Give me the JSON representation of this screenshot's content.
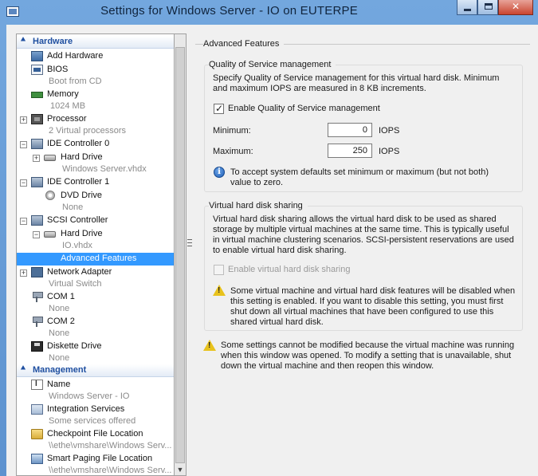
{
  "window": {
    "title": "Settings for Windows Server - IO on EUTERPE"
  },
  "tree": {
    "hardware_header": "Hardware",
    "management_header": "Management",
    "hardware_items": [
      {
        "label": "Add Hardware",
        "icon": "add-hardware-icon"
      },
      {
        "label": "BIOS",
        "sub": "Boot from CD",
        "icon": "bios-icon"
      },
      {
        "label": "Memory",
        "sub": "1024 MB",
        "icon": "memory-icon"
      },
      {
        "label": "Processor",
        "sub": "2 Virtual processors",
        "icon": "processor-icon"
      },
      {
        "label": "IDE Controller 0",
        "icon": "ide-controller-icon"
      },
      {
        "label": "Hard Drive",
        "sub": "Windows Server.vhdx",
        "icon": "hard-drive-icon"
      },
      {
        "label": "IDE Controller 1",
        "icon": "ide-controller-icon"
      },
      {
        "label": "DVD Drive",
        "sub": "None",
        "icon": "dvd-drive-icon"
      },
      {
        "label": "SCSI Controller",
        "icon": "scsi-controller-icon"
      },
      {
        "label": "Hard Drive",
        "sub": "IO.vhdx",
        "icon": "hard-drive-icon"
      },
      {
        "label": "Advanced Features",
        "selected": true
      },
      {
        "label": "Network Adapter",
        "sub": "Virtual Switch",
        "icon": "network-adapter-icon"
      },
      {
        "label": "COM 1",
        "sub": "None",
        "icon": "com-port-icon"
      },
      {
        "label": "COM 2",
        "sub": "None",
        "icon": "com-port-icon"
      },
      {
        "label": "Diskette Drive",
        "sub": "None",
        "icon": "diskette-drive-icon"
      }
    ],
    "management_items": [
      {
        "label": "Name",
        "sub": "Windows Server - IO",
        "icon": "name-icon"
      },
      {
        "label": "Integration Services",
        "sub": "Some services offered",
        "icon": "integration-services-icon"
      },
      {
        "label": "Checkpoint File Location",
        "sub": "\\\\ethe\\vmshare\\Windows Serv...",
        "icon": "checkpoint-folder-icon"
      },
      {
        "label": "Smart Paging File Location",
        "sub": "\\\\ethe\\vmshare\\Windows Serv...",
        "icon": "smart-paging-icon"
      }
    ]
  },
  "advanced": {
    "title": "Advanced Features",
    "qos": {
      "title": "Quality of Service management",
      "description": "Specify Quality of Service management for this virtual hard disk. Minimum and maximum IOPS are measured in 8 KB increments.",
      "enable_label": "Enable Quality of Service management",
      "enable_checked": true,
      "minimum_label": "Minimum:",
      "minimum_value": "0",
      "maximum_label": "Maximum:",
      "maximum_value": "250",
      "unit": "IOPS",
      "info_text": "To accept system defaults set minimum or maximum (but not both) value to zero."
    },
    "sharing": {
      "title": "Virtual hard disk sharing",
      "description": "Virtual hard disk sharing allows the virtual hard disk to be used as shared storage by multiple virtual machines at the same time. This is typically useful in virtual machine clustering scenarios. SCSI-persistent reservations are used to enable virtual hard disk sharing.",
      "enable_label": "Enable virtual hard disk sharing",
      "enable_checked": false,
      "warning_text": "Some virtual machine and virtual hard disk features will be disabled when this setting is enabled. If you want to disable this setting, you must first shut down all virtual machines that have been configured to use this shared virtual hard disk."
    },
    "bottom_warning": "Some settings cannot be modified because the virtual machine was running when this window was opened. To modify a setting that is unavailable, shut down the virtual machine and then reopen this window."
  }
}
